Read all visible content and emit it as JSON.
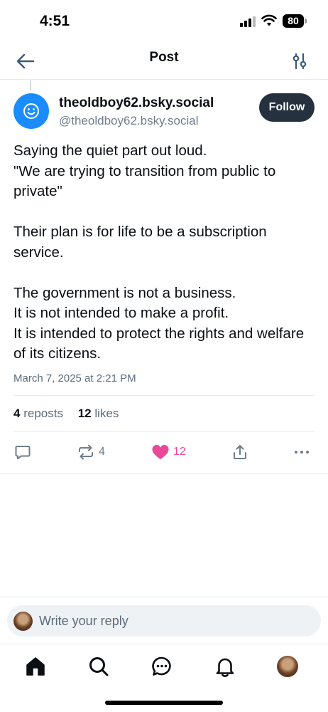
{
  "status_bar": {
    "time": "4:51",
    "battery": "80"
  },
  "header": {
    "title": "Post",
    "back_icon": "arrow-left-icon",
    "settings_icon": "sliders-icon"
  },
  "post": {
    "author": {
      "display_name": "theoldboy62.bsky.social",
      "handle": "@theoldboy62.bsky.social",
      "avatar_icon": "smiley-icon",
      "avatar_color": "#1a8cff"
    },
    "follow_label": "Follow",
    "paragraphs": [
      [
        "Saying the quiet part out loud.",
        "\"We are trying to transition from public to private\""
      ],
      [
        "Their plan is for life to be a subscription service."
      ],
      [
        "The government is not a business.",
        "It is not intended to make a profit.",
        "It is intended to protect the rights and welfare of its citizens."
      ]
    ],
    "timestamp": "March 7, 2025 at 2:21 PM",
    "stats": {
      "reposts_count": "4",
      "reposts_label": "reposts",
      "likes_count": "12",
      "likes_label": "likes"
    },
    "actions": {
      "reply_icon": "speech-bubble-icon",
      "repost_icon": "repost-icon",
      "repost_count": "4",
      "like_icon": "heart-icon",
      "like_count": "12",
      "like_color": "#ec4899",
      "share_icon": "share-icon",
      "more_icon": "ellipsis-icon"
    }
  },
  "reply_bar": {
    "placeholder": "Write your reply"
  },
  "bottom_nav": {
    "items": [
      "home-icon",
      "search-icon",
      "chat-icon",
      "bell-icon",
      "profile-avatar"
    ]
  },
  "colors": {
    "accent": "#1a8cff",
    "follow_button": "#263140",
    "secondary_text": "#5b6b7c"
  }
}
